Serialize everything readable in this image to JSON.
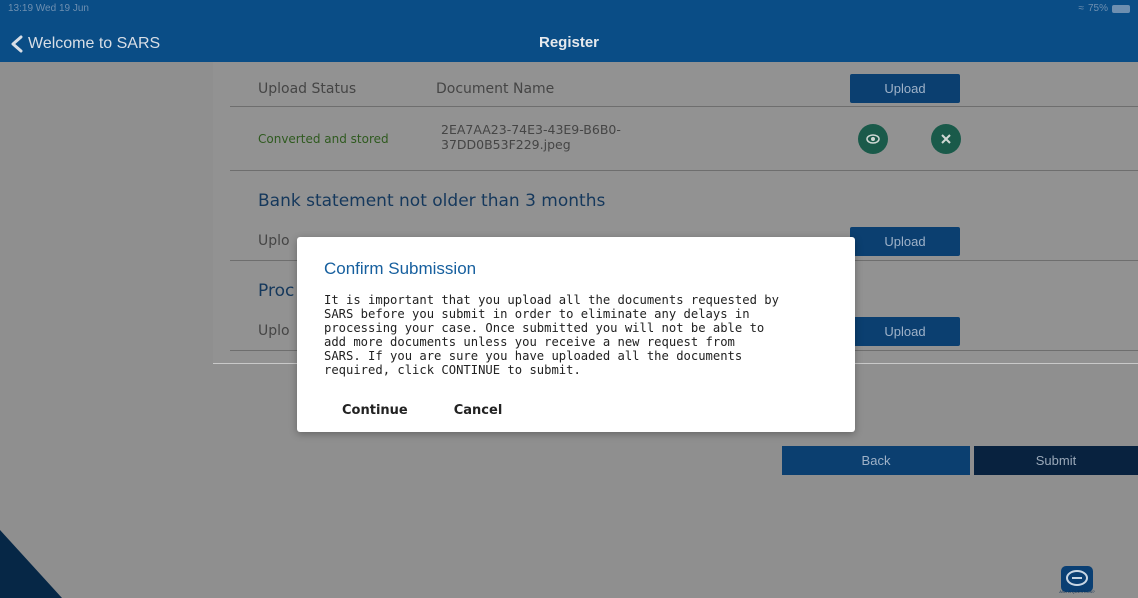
{
  "status_bar": {
    "time": "13:19 Wed 19 Jun",
    "battery": "75%"
  },
  "nav": {
    "back_label": "Welcome to SARS",
    "title": "Register"
  },
  "documents_table": {
    "col_status": "Upload Status",
    "col_name": "Document Name",
    "upload_label": "Upload",
    "rows": [
      {
        "status": "Converted and stored",
        "name_line1": "2EA7AA23-74E3-43E9-B6B0-",
        "name_line2": "37DD0B53F229.jpeg"
      }
    ]
  },
  "bank_section": {
    "title": "Bank statement not older than 3 months",
    "upload_status_partial": "Uplo",
    "upload_label": "Upload"
  },
  "proof_section": {
    "title_partial": "Proc",
    "upload_status_partial": "Uplo",
    "upload_label": "Upload"
  },
  "actions": {
    "back_label": "Back",
    "submit_label": "Submit"
  },
  "modal": {
    "title": "Confirm Submission",
    "body_lines": [
      "It is important that you upload all the documents requested by",
      "SARS before you submit in order to eliminate any delays in",
      "processing your case. Once submitted you will not be able to",
      "add more documents unless you receive a new request from",
      "SARS. If you are sure you have uploaded all the documents",
      "required, click CONTINUE to submit."
    ],
    "continue_label": "Continue",
    "cancel_label": "Cancel"
  },
  "help": {
    "label": "ASK A QUESTION?"
  },
  "colors": {
    "nav_blue": "#0a4d86",
    "button_blue": "#0b3f70",
    "modal_title": "#165f9e",
    "status_green": "#3d6b28"
  }
}
